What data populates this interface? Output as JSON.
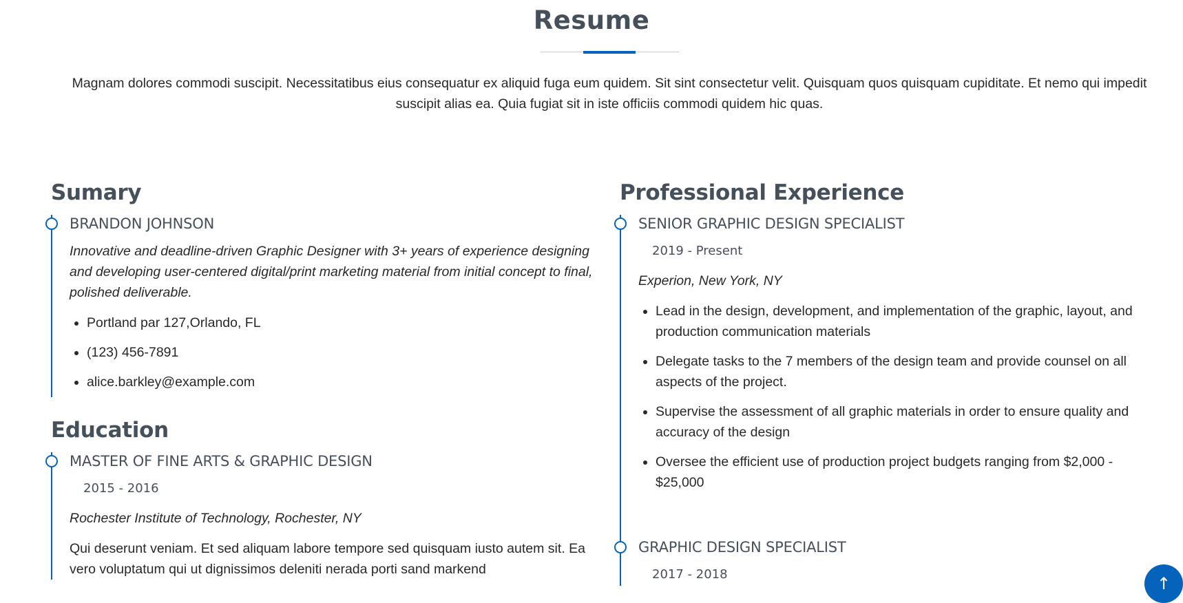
{
  "header": {
    "title": "Resume",
    "intro": "Magnam dolores commodi suscipit. Necessitatibus eius consequatur ex aliquid fuga eum quidem. Sit sint consectetur velit. Quisquam quos quisquam cupiditate. Et nemo qui impedit suscipit alias ea. Quia fugiat sit in iste officiis commodi quidem hic quas."
  },
  "summary": {
    "heading": "Sumary",
    "name": "BRANDON JOHNSON",
    "description": "Innovative and deadline-driven Graphic Designer with 3+ years of experience designing and developing user-centered digital/print marketing material from initial concept to final, polished deliverable.",
    "contacts": [
      "Portland par 127,Orlando, FL",
      "(123) 456-7891",
      "alice.barkley@example.com"
    ]
  },
  "education": {
    "heading": "Education",
    "items": [
      {
        "degree": "MASTER OF FINE ARTS & GRAPHIC DESIGN",
        "years": "2015 - 2016",
        "school": "Rochester Institute of Technology, Rochester, NY",
        "text": "Qui deserunt veniam. Et sed aliquam labore tempore sed quisquam iusto autem sit. Ea vero voluptatum qui ut dignissimos deleniti nerada porti sand markend"
      }
    ]
  },
  "experience": {
    "heading": "Professional Experience",
    "items": [
      {
        "title": "SENIOR GRAPHIC DESIGN SPECIALIST",
        "years": "2019 - Present",
        "company": "Experion, New York, NY",
        "bullets": [
          "Lead in the design, development, and implementation of the graphic, layout, and production communication materials",
          "Delegate tasks to the 7 members of the design team and provide counsel on all aspects of the project.",
          "Supervise the assessment of all graphic materials in order to ensure quality and accuracy of the design",
          "Oversee the efficient use of production project budgets ranging from $2,000 - $25,000"
        ]
      },
      {
        "title": "GRAPHIC DESIGN SPECIALIST",
        "years": "2017 - 2018"
      }
    ]
  },
  "back_to_top": {
    "icon": "arrow-up-icon",
    "glyph": "↑"
  },
  "colors": {
    "accent": "#0563bb",
    "heading": "#45505b",
    "text": "#272829"
  }
}
